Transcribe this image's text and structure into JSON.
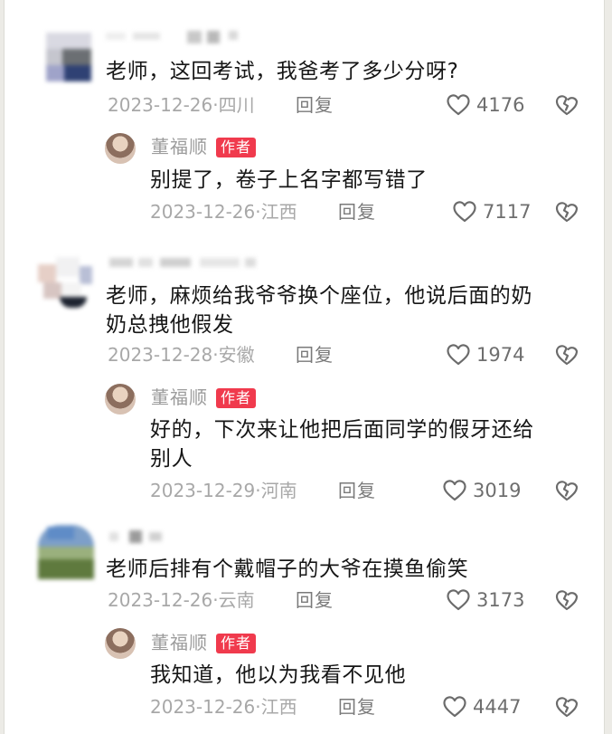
{
  "colors": {
    "accent": "#f03a4d",
    "text": "#161616",
    "meta": "#a8a8a8"
  },
  "comments": [
    {
      "text": "老师，这回考试，我爸考了多少分呀?",
      "date": "2023-12-26",
      "location": "四川",
      "reply_label": "回复",
      "likes": "4176",
      "reply": {
        "author": "董福顺",
        "badge": "作者",
        "lines": [
          "别提了，卷子上名字都写错了"
        ],
        "date": "2023-12-26",
        "location": "江西",
        "reply_label": "回复",
        "likes": "7117"
      }
    },
    {
      "lines": [
        "老师，麻烦给我爷爷换个座位，他说后面的奶",
        "奶总拽他假发"
      ],
      "date": "2023-12-28",
      "location": "安徽",
      "reply_label": "回复",
      "likes": "1974",
      "reply": {
        "author": "董福顺",
        "badge": "作者",
        "lines": [
          "好的，下次来让他把后面同学的假牙还给",
          "别人"
        ],
        "date": "2023-12-29",
        "location": "河南",
        "reply_label": "回复",
        "likes": "3019"
      }
    },
    {
      "text": "老师后排有个戴帽子的大爷在摸鱼偷笑",
      "date": "2023-12-26",
      "location": "云南",
      "reply_label": "回复",
      "likes": "3173",
      "reply": {
        "author": "董福顺",
        "badge": "作者",
        "lines": [
          "我知道，他以为我看不见他"
        ],
        "date": "2023-12-26",
        "location": "江西",
        "reply_label": "回复",
        "likes": "4447"
      }
    }
  ]
}
